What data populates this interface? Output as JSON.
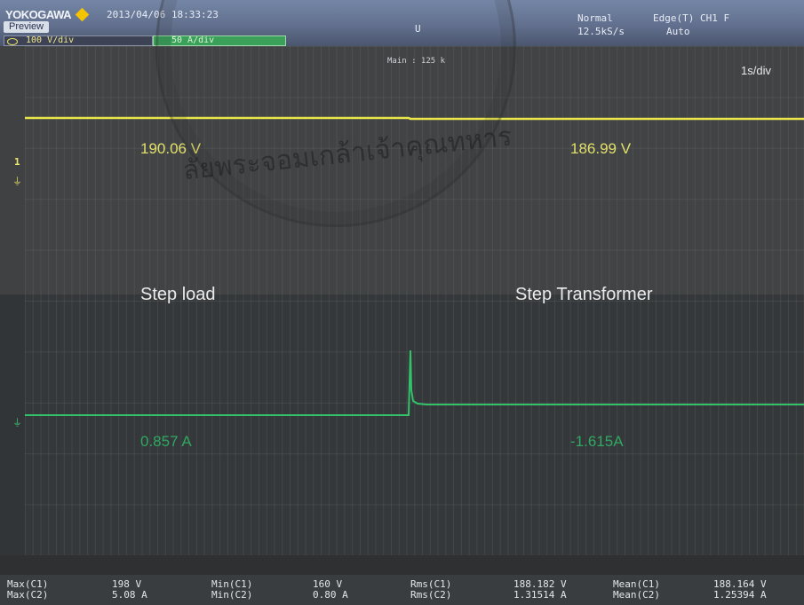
{
  "header": {
    "brand": "YOKOGAWA",
    "datetime": "2013/04/06 18:33:23",
    "center_mark": "U",
    "acquisition_mode": "Normal",
    "sample_rate": "12.5kS/s",
    "trigger": "Edge(T) CH1 F",
    "trigger_mode": "Auto",
    "preview_tab": "Preview",
    "ch1_scale": "100 V/div",
    "ch2_scale": "50 A/div"
  },
  "display": {
    "main_label": "Main : 125 k",
    "timebase": "1s/div",
    "ch1_marker": "1",
    "ground_symbol": "⏚"
  },
  "annotations": {
    "voltage_before": "190.06 V",
    "voltage_after": "186.99 V",
    "event_1": "Step load",
    "event_2": "Step Transformer",
    "current_before": "0.857 A",
    "current_after": "-1.615A"
  },
  "measurements": {
    "max_labels": "Max(C1)\nMax(C2)",
    "max_values": "198 V\n5.08 A",
    "min_labels": "Min(C1)\nMin(C2)",
    "min_values": "160 V\n0.80 A",
    "rms_labels": "Rms(C1)\nRms(C2)",
    "rms_values": "188.182 V\n1.31514 A",
    "mean_labels": "Mean(C1)\nMean(C2)",
    "mean_values": "188.164 V\n1.25394 A"
  },
  "watermark": {
    "seal_text": "ลัยพระจอมเกล้าเจ้าคุณทหาร"
  },
  "colors": {
    "ch1_trace": "#e8e64a",
    "ch2_trace": "#33c26a",
    "grid": "#4a4d50"
  }
}
